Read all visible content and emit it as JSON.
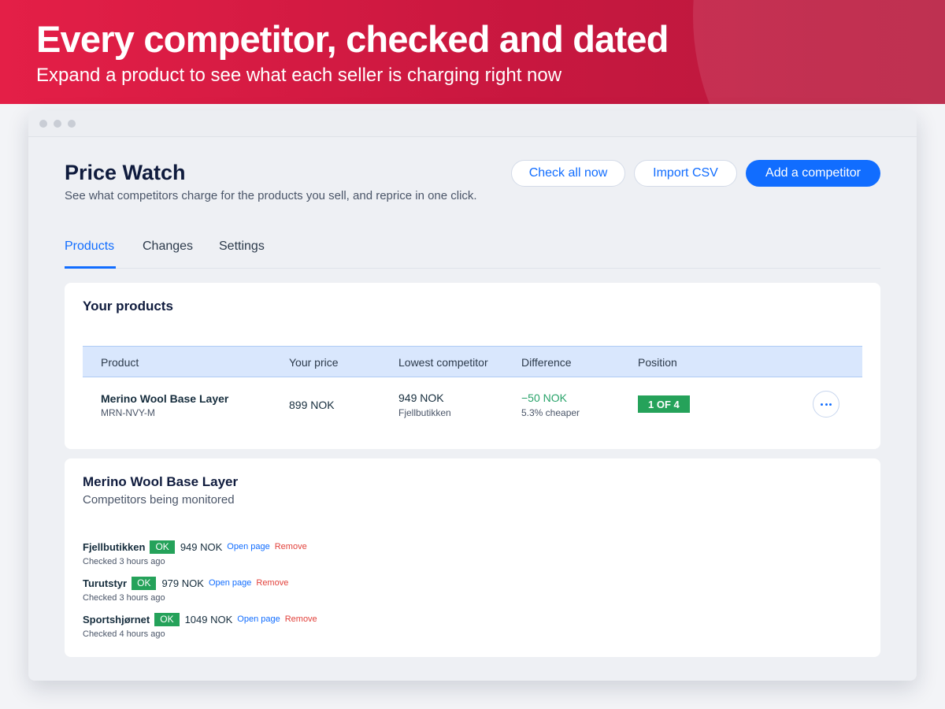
{
  "banner": {
    "headline": "Every competitor, checked and dated",
    "subhead": "Expand a product to see what each seller is charging right now"
  },
  "app": {
    "title": "Price Watch",
    "subtitle": "See what competitors charge for the products you sell, and reprice in one click."
  },
  "actions": {
    "check_all": "Check all now",
    "import_csv": "Import CSV",
    "add_competitor": "Add a competitor"
  },
  "tabs": [
    {
      "label": "Products",
      "active": true
    },
    {
      "label": "Changes",
      "active": false
    },
    {
      "label": "Settings",
      "active": false
    }
  ],
  "products": {
    "title": "Your products",
    "columns": [
      "Product",
      "Your price",
      "Lowest competitor",
      "Difference",
      "Position"
    ],
    "rows": [
      {
        "name": "Merino Wool Base Layer",
        "sku": "MRN-NVY-M",
        "your_price": "899 NOK",
        "lowest_price": "949 NOK",
        "lowest_seller": "Fjellbutikken",
        "difference": "−50 NOK",
        "difference_pct": "5.3% cheaper",
        "position": "1 OF 4"
      }
    ]
  },
  "detail": {
    "title": "Merino Wool Base Layer",
    "subtitle": "Competitors being monitored",
    "open_label": "Open page",
    "remove_label": "Remove",
    "competitors": [
      {
        "name": "Fjellbutikken",
        "status": "OK",
        "price": "949 NOK",
        "checked": "Checked 3 hours ago"
      },
      {
        "name": "Turutstyr",
        "status": "OK",
        "price": "979 NOK",
        "checked": "Checked 3 hours ago"
      },
      {
        "name": "Sportshjørnet",
        "status": "OK",
        "price": "1049 NOK",
        "checked": "Checked 4 hours ago"
      }
    ]
  },
  "colors": {
    "brand_red": "#e41f47",
    "accent_blue": "#116dff",
    "success_green": "#25a25a",
    "danger_red": "#e2413b"
  }
}
